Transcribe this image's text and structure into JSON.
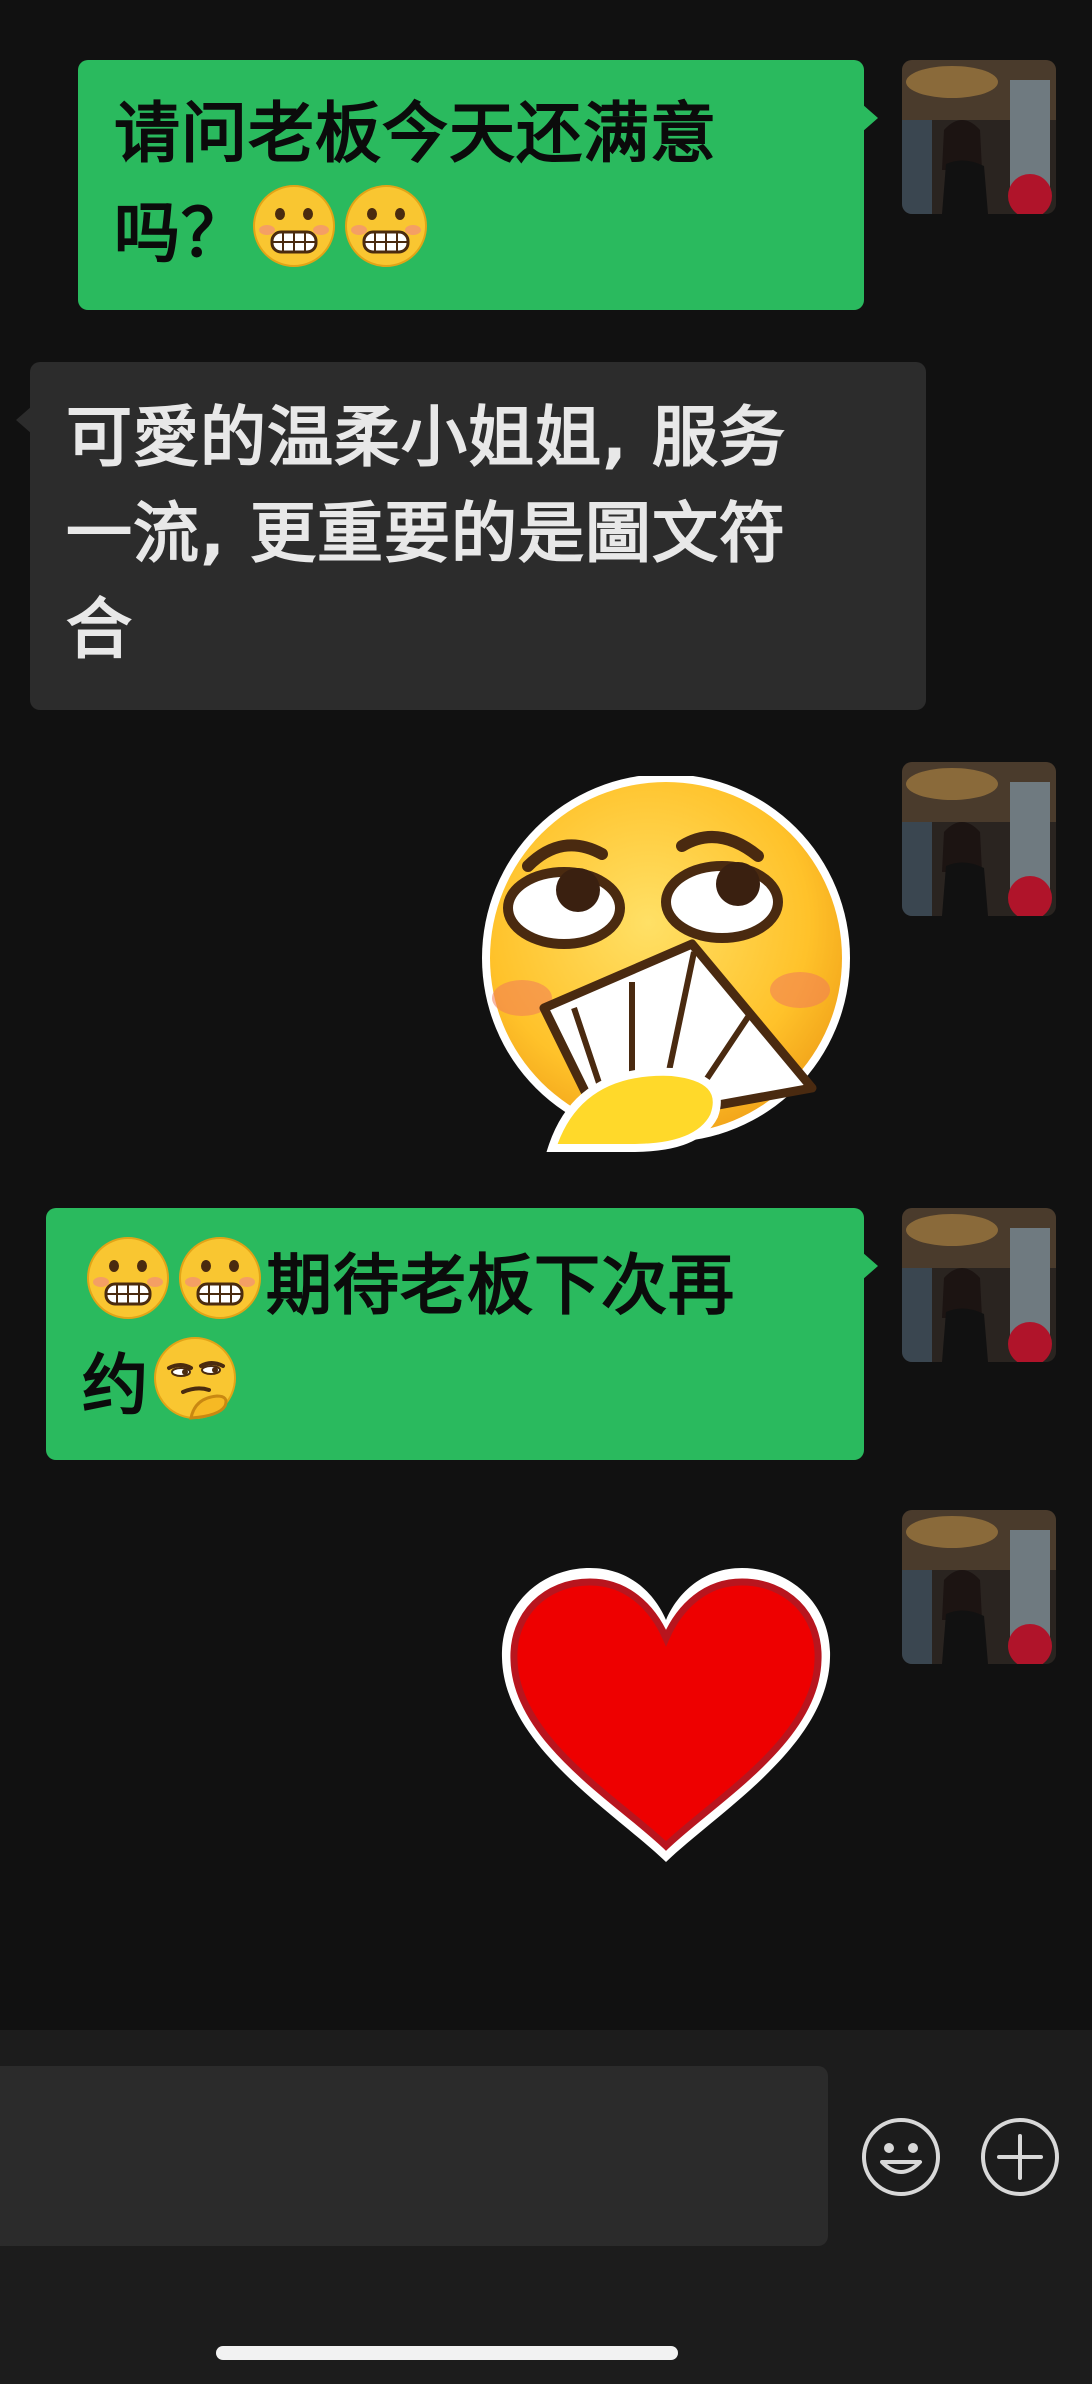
{
  "messages": [
    {
      "side": "outgoing",
      "text": "请问老板今天还满意",
      "text2": "吗？",
      "emojis": [
        "grimace-emoji",
        "grimace-emoji"
      ]
    },
    {
      "side": "incoming",
      "line1": "可愛的温柔小姐姐, 服务",
      "line2": "一流, 更重要的是圖文符",
      "line3": "合"
    },
    {
      "side": "outgoing",
      "sticker": "shy-fan-face-sticker"
    },
    {
      "side": "outgoing",
      "emojis_lead": [
        "grimace-emoji",
        "grimace-emoji"
      ],
      "text": "期待老板下次再",
      "text2": "约",
      "emojis_tail": [
        "smirk-thinking-emoji"
      ]
    },
    {
      "side": "outgoing",
      "sticker": "red-heart-sticker"
    }
  ],
  "input_bar": {
    "emoji_button": "smiley-icon",
    "more_button": "plus-icon"
  },
  "colors": {
    "background": "#111111",
    "outgoing_bubble": "#2aba5e",
    "incoming_bubble": "#2c2c2c"
  }
}
